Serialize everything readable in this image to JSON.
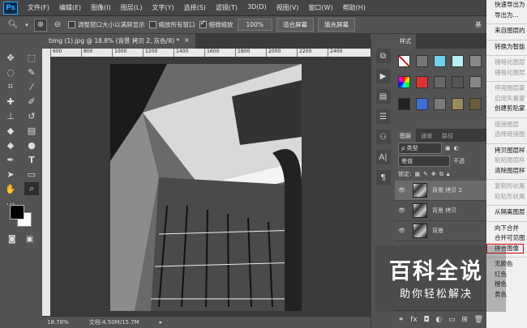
{
  "app": {
    "logo": "Ps"
  },
  "menu": [
    "文件(F)",
    "编辑(E)",
    "图像(I)",
    "图层(L)",
    "文字(Y)",
    "选择(S)",
    "滤镜(T)",
    "3D(D)",
    "视图(V)",
    "窗口(W)",
    "帮助(H)"
  ],
  "options": {
    "resize_windows": "调整窗口大小以满屏显示",
    "zoom_all": "缩放所有窗口",
    "scrubby_zoom": "细微缩放",
    "zoom_100": "100%",
    "fit_screen": "适合屏幕",
    "fill_screen": "填充屏幕",
    "right_label": "基"
  },
  "document": {
    "tab_title": "timg (1).jpg @ 18.8% (背景 拷贝 2, 灰色/8) *",
    "close": "×"
  },
  "ruler": [
    "600",
    "800",
    "1000",
    "1200",
    "1400",
    "1600",
    "1800",
    "2000",
    "2200",
    "2400"
  ],
  "status": {
    "zoom": "18.78%",
    "doc_size": "文档:4.50M/15.7M"
  },
  "styles_panel": {
    "tab": "样式"
  },
  "layers_panel": {
    "tabs": [
      "图层",
      "通道",
      "路径"
    ],
    "filter": "ρ 类型",
    "blend_mode": "差值",
    "opacity_label": "不透",
    "lock_label": "锁定:",
    "layers": [
      {
        "name": "背景 拷贝 2",
        "selected": true
      },
      {
        "name": "背景 拷贝",
        "selected": false
      },
      {
        "name": "背景",
        "selected": false
      }
    ]
  },
  "context_menu": [
    {
      "label": "快速导出为",
      "disabled": false
    },
    {
      "label": "导出为...",
      "disabled": false
    },
    {
      "label": "",
      "sep": true
    },
    {
      "label": "来自图层的",
      "disabled": false
    },
    {
      "label": "",
      "sep": true
    },
    {
      "label": "转换为智能",
      "disabled": false
    },
    {
      "label": "",
      "sep": true
    },
    {
      "label": "栅格化图层",
      "disabled": true
    },
    {
      "label": "栅格化图层",
      "disabled": true
    },
    {
      "label": "",
      "sep": true
    },
    {
      "label": "停用图层蒙",
      "disabled": true
    },
    {
      "label": "启用矢量蒙",
      "disabled": true
    },
    {
      "label": "创建剪贴蒙",
      "disabled": false
    },
    {
      "label": "",
      "sep": true
    },
    {
      "label": "链接图层",
      "disabled": true
    },
    {
      "label": "选择链接图",
      "disabled": true
    },
    {
      "label": "",
      "sep": true
    },
    {
      "label": "拷贝图层样",
      "disabled": false
    },
    {
      "label": "粘贴图层样",
      "disabled": true
    },
    {
      "label": "清除图层样",
      "disabled": false
    },
    {
      "label": "",
      "sep": true
    },
    {
      "label": "复制形状属",
      "disabled": true
    },
    {
      "label": "粘贴形状属",
      "disabled": true
    },
    {
      "label": "",
      "sep": true
    },
    {
      "label": "从隔离图层",
      "disabled": false
    },
    {
      "label": "",
      "sep": true
    },
    {
      "label": "向下合并",
      "disabled": false
    },
    {
      "label": "合并可见图",
      "disabled": false
    },
    {
      "label": "拼合图像",
      "disabled": false,
      "highlight": true
    },
    {
      "label": "",
      "sep": true
    },
    {
      "label": "无颜色",
      "disabled": false
    },
    {
      "label": "红色",
      "disabled": false
    },
    {
      "label": "橙色",
      "disabled": false
    },
    {
      "label": "黄色",
      "disabled": false
    }
  ],
  "watermark": {
    "title": "百科全说",
    "subtitle": "助你轻松解决"
  },
  "colors": {
    "accent": "#31a8ff",
    "highlight_border": "#dd0000"
  }
}
